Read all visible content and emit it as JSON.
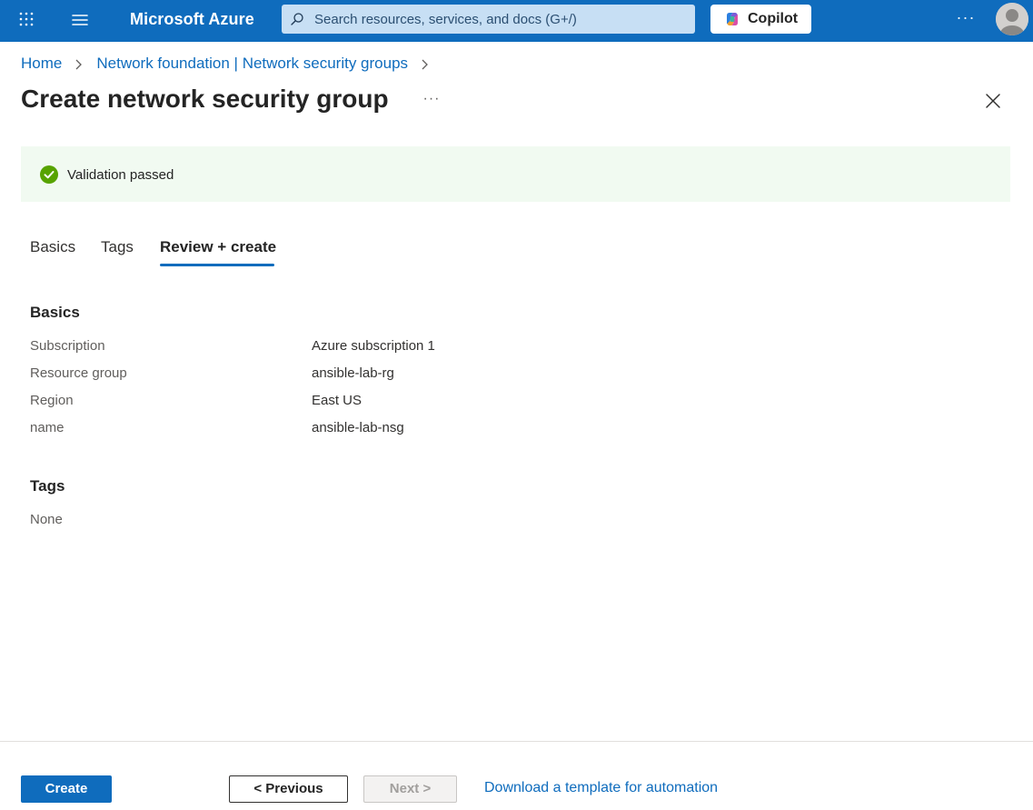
{
  "topbar": {
    "brand": "Microsoft Azure",
    "search_placeholder": "Search resources, services, and docs (G+/)",
    "copilot_label": "Copilot",
    "more_label": "···",
    "icons": [
      "waffle-icon",
      "hamburger-menu-icon",
      "search-icon",
      "copilot-icon",
      "more-icon",
      "avatar"
    ],
    "colors": {
      "bar": "#0f6cbd",
      "search_bg": "#c7dff4"
    }
  },
  "breadcrumb": {
    "items": [
      "Home",
      "Network foundation | Network security groups"
    ]
  },
  "page": {
    "title": "Create network security group",
    "more_label": "···"
  },
  "banner": {
    "text": "Validation passed",
    "status_color": "#57a300",
    "bg_color": "#f1faf1"
  },
  "tabs": [
    {
      "label": "Basics",
      "active": false
    },
    {
      "label": "Tags",
      "active": false
    },
    {
      "label": "Review + create",
      "active": true
    }
  ],
  "review": {
    "basics_heading": "Basics",
    "rows": [
      {
        "label": "Subscription",
        "value": "Azure subscription 1"
      },
      {
        "label": "Resource group",
        "value": "ansible-lab-rg"
      },
      {
        "label": "Region",
        "value": "East US"
      },
      {
        "label": "name",
        "value": "ansible-lab-nsg"
      }
    ],
    "tags_heading": "Tags",
    "tags_value": "None"
  },
  "footer": {
    "create_label": "Create",
    "previous_label": "< Previous",
    "next_label": "Next >",
    "download_label": "Download a template for automation"
  }
}
